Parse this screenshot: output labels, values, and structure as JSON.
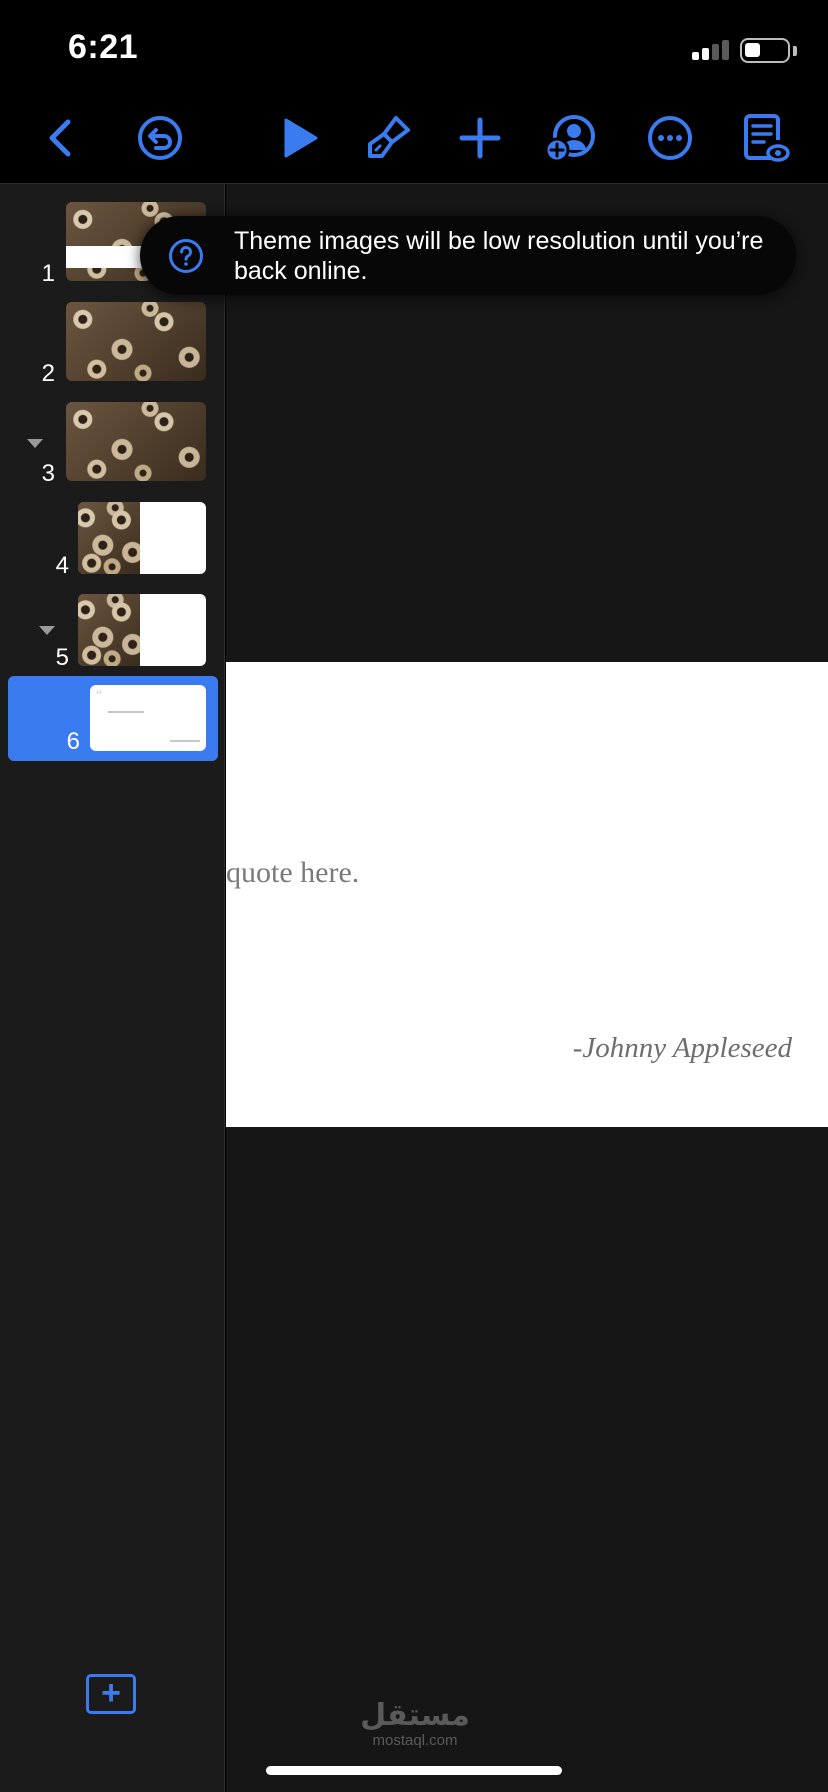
{
  "status_bar": {
    "time": "6:21"
  },
  "toolbar": {
    "buttons": [
      {
        "name": "back-icon"
      },
      {
        "name": "undo-icon"
      },
      {
        "name": "play-icon"
      },
      {
        "name": "paintbrush-icon"
      },
      {
        "name": "plus-icon"
      },
      {
        "name": "collaborate-icon"
      },
      {
        "name": "more-icon"
      },
      {
        "name": "presenter-notes-icon"
      }
    ],
    "accent_color": "#3a7bf0"
  },
  "navigator": {
    "slides": [
      {
        "number": "1",
        "collapsed_group": false
      },
      {
        "number": "2",
        "collapsed_group": false
      },
      {
        "number": "3",
        "collapsed_group": true
      },
      {
        "number": "4",
        "collapsed_group": false
      },
      {
        "number": "5",
        "collapsed_group": true
      },
      {
        "number": "6",
        "collapsed_group": false,
        "selected": true
      }
    ],
    "add_slide_icon": "add-slide-icon"
  },
  "slide": {
    "quote": "quote here.",
    "author": "-Johnny Appleseed"
  },
  "toast": {
    "message": "Theme images will be low resolution until you’re back online.",
    "icon": "question-circle-icon"
  },
  "watermark": {
    "arabic": "مستقل",
    "latin": "mostaql.com"
  }
}
